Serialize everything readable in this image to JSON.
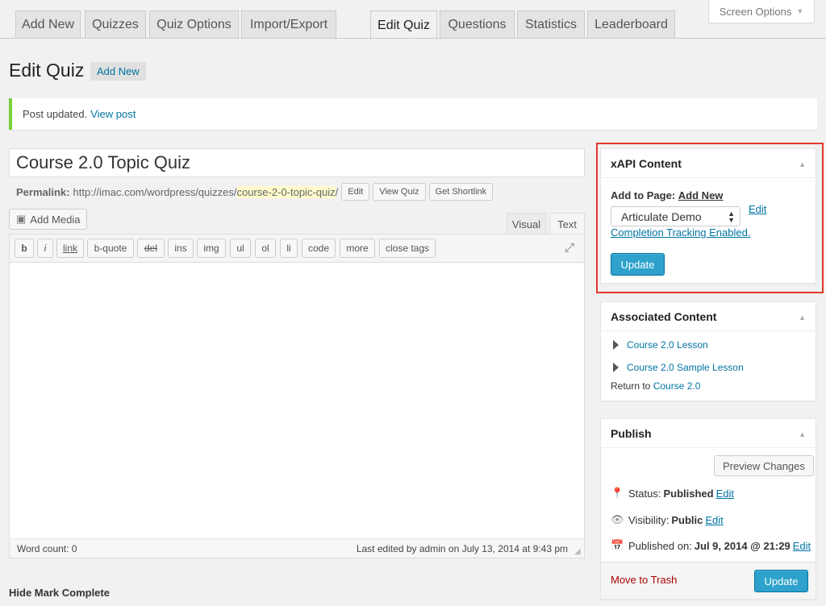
{
  "tabs": [
    "Add New",
    "Quizzes",
    "Quiz Options",
    "Import/Export",
    "Edit Quiz",
    "Questions",
    "Statistics",
    "Leaderboard"
  ],
  "screen_options": "Screen Options",
  "page": {
    "title": "Edit Quiz",
    "add_new": "Add New"
  },
  "notice": {
    "text": "Post updated.",
    "link": "View post"
  },
  "post": {
    "title": "Course 2.0 Topic Quiz",
    "permalink_label": "Permalink:",
    "permalink_base": "http://imac.com/wordpress/quizzes/",
    "slug": "course-2-0-topic-quiz",
    "slug_suffix": "/",
    "buttons": {
      "edit": "Edit",
      "view": "View Quiz",
      "shortlink": "Get Shortlink"
    }
  },
  "editor": {
    "add_media": "Add Media",
    "modes": {
      "visual": "Visual",
      "text": "Text"
    },
    "quicktags": [
      "b",
      "i",
      "link",
      "b-quote",
      "del",
      "ins",
      "img",
      "ul",
      "ol",
      "li",
      "code",
      "more",
      "close tags"
    ],
    "word_count": "Word count: 0",
    "last_edited": "Last edited by admin on July 13, 2014 at 9:43 pm"
  },
  "hide_mark_complete": "Hide Mark Complete",
  "xapi": {
    "heading": "xAPI Content",
    "add_to_page": "Add to Page:",
    "add_new": "Add New",
    "selected": "Articulate Demo",
    "edit": "Edit",
    "tracking": "Completion Tracking Enabled.",
    "update": "Update"
  },
  "associated": {
    "heading": "Associated Content",
    "items": [
      "Course 2.0 Lesson",
      "Course 2.0 Sample Lesson"
    ],
    "return_prefix": "Return to",
    "return_link": "Course 2.0"
  },
  "publish": {
    "heading": "Publish",
    "preview": "Preview Changes",
    "status_label": "Status:",
    "status_value": "Published",
    "visibility_label": "Visibility:",
    "visibility_value": "Public",
    "published_label": "Published on:",
    "published_value": "Jul 9, 2014 @ 21:29",
    "edit": "Edit",
    "trash": "Move to Trash",
    "update": "Update"
  },
  "colors": {
    "accent": "#2ea2cc",
    "link": "#0074a2",
    "notice_border": "#7ad03a",
    "highlight_frame": "#e4372b",
    "trash": "#aa0000"
  },
  "icons": [
    "dropdown-arrow-icon",
    "add-media-icon",
    "fullscreen-icon",
    "resize-grip-icon",
    "collapse-arrow-icon",
    "pin-icon",
    "eye-icon",
    "calendar-icon",
    "triangle-right-icon"
  ]
}
